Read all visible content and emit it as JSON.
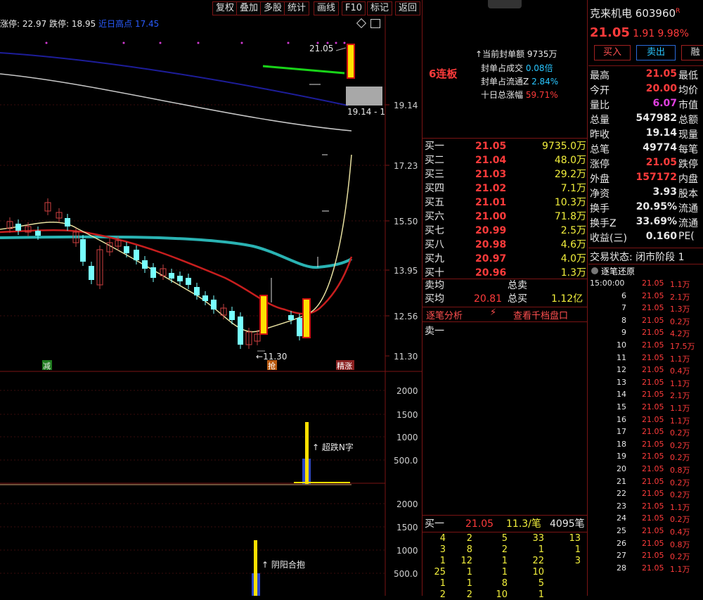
{
  "toolbar": {
    "buttons": [
      "复权",
      "叠加",
      "多股",
      "统计",
      "画线",
      "F10",
      "标记",
      "返回"
    ]
  },
  "chart_header": {
    "limit_up": "涨停: 22.97",
    "limit_down": "跌停: 18.95",
    "recent_label": "近日高点",
    "recent_value": "17.45"
  },
  "price_axis": [
    "19.14",
    "17.23",
    "15.50",
    "13.95",
    "12.56",
    "11.30"
  ],
  "annotations": {
    "last_high": "21.05",
    "prev_close": "19.14 - 1",
    "low_label": "11.30",
    "tag_left": "减",
    "tag_mid": "抢",
    "tag_right": "精涨"
  },
  "vol1": {
    "axis": [
      "2000",
      "1500",
      "1000",
      "500.0"
    ],
    "signal": "超跌N字"
  },
  "vol2": {
    "axis": [
      "2000",
      "1500",
      "1000",
      "500.0"
    ],
    "signal": "阴阳合抱"
  },
  "seal_info": {
    "title": "6连板",
    "rows": [
      {
        "label": "当前封单额",
        "value": "9735万"
      },
      {
        "label": "封单占成交",
        "value": "0.08倍"
      },
      {
        "label": "封单占流通Z",
        "value": "2.84%"
      },
      {
        "label": "十日总涨幅",
        "value": "59.71%"
      }
    ]
  },
  "book": {
    "bids": [
      {
        "label": "买一",
        "price": "21.05",
        "vol": "9735.0万"
      },
      {
        "label": "买二",
        "price": "21.04",
        "vol": "48.0万"
      },
      {
        "label": "买三",
        "price": "21.03",
        "vol": "29.2万"
      },
      {
        "label": "买四",
        "price": "21.02",
        "vol": "7.1万"
      },
      {
        "label": "买五",
        "price": "21.01",
        "vol": "10.3万"
      },
      {
        "label": "买六",
        "price": "21.00",
        "vol": "71.8万"
      },
      {
        "label": "买七",
        "price": "20.99",
        "vol": "2.5万"
      },
      {
        "label": "买八",
        "price": "20.98",
        "vol": "4.6万"
      },
      {
        "label": "买九",
        "price": "20.97",
        "vol": "4.0万"
      },
      {
        "label": "买十",
        "price": "20.96",
        "vol": "1.3万"
      }
    ],
    "ask_avg_label": "卖均",
    "ask_total_label": "总卖",
    "bid_avg_label": "买均",
    "bid_avg": "20.81",
    "bid_total_label": "总买",
    "bid_total": "1.12亿",
    "tab_tick": "逐笔分析",
    "tab_depth": "查看千档盘口",
    "sell1": "卖一",
    "queue_header": {
      "label": "买一",
      "price": "21.05",
      "per": "11.3/笔",
      "count": "4095笔"
    },
    "queue": [
      [
        "4",
        "2",
        "5",
        "33",
        "13"
      ],
      [
        "3",
        "8",
        "2",
        "1",
        "1"
      ],
      [
        "1",
        "12",
        "1",
        "22",
        "3"
      ],
      [
        "25",
        "1",
        "1",
        "10",
        ""
      ],
      [
        "1",
        "1",
        "8",
        "5",
        ""
      ],
      [
        "2",
        "2",
        "10",
        "1",
        ""
      ]
    ]
  },
  "stock": {
    "name": "克来机电",
    "code": "603960",
    "flag": "R",
    "price": "21.05",
    "change": "1.91",
    "pct": "9.98%",
    "buy": "买入",
    "sell": "卖出",
    "more": "融"
  },
  "stats": [
    {
      "l": "最高",
      "v": "21.05",
      "c": "red",
      "r": "最低"
    },
    {
      "l": "今开",
      "v": "20.00",
      "c": "red",
      "r": "均价"
    },
    {
      "l": "量比",
      "v": "6.07",
      "c": "magenta",
      "r": "市值"
    },
    {
      "l": "总量",
      "v": "547982",
      "c": "white",
      "r": "总额"
    },
    {
      "l": "昨收",
      "v": "19.14",
      "c": "white",
      "r": "现量"
    },
    {
      "l": "总笔",
      "v": "49774",
      "c": "white",
      "r": "每笔"
    },
    {
      "l": "涨停",
      "v": "21.05",
      "c": "red",
      "r": "跌停"
    },
    {
      "l": "外盘",
      "v": "157172",
      "c": "red",
      "r": "内盘"
    },
    {
      "l": "净资",
      "v": "3.93",
      "c": "white",
      "r": "股本"
    },
    {
      "l": "换手",
      "v": "20.95%",
      "c": "white",
      "r": "流通"
    },
    {
      "l": "换手Z",
      "v": "33.69%",
      "c": "white",
      "r": "流通"
    },
    {
      "l": "收益(三)",
      "v": "0.160",
      "c": "white",
      "r": "PE("
    }
  ],
  "trade_status": "交易状态: 闭市阶段 1",
  "tick_title": "逐笔还原",
  "ticks": [
    {
      "t": "15:00:00",
      "p": "21.05",
      "v": "1.1万"
    },
    {
      "t": "6",
      "p": "21.05",
      "v": "2.1万"
    },
    {
      "t": "7",
      "p": "21.05",
      "v": "1.3万"
    },
    {
      "t": "8",
      "p": "21.05",
      "v": "0.2万"
    },
    {
      "t": "9",
      "p": "21.05",
      "v": "4.2万"
    },
    {
      "t": "10",
      "p": "21.05",
      "v": "17.5万"
    },
    {
      "t": "11",
      "p": "21.05",
      "v": "1.1万"
    },
    {
      "t": "12",
      "p": "21.05",
      "v": "0.4万"
    },
    {
      "t": "13",
      "p": "21.05",
      "v": "1.1万"
    },
    {
      "t": "14",
      "p": "21.05",
      "v": "2.1万"
    },
    {
      "t": "15",
      "p": "21.05",
      "v": "1.1万"
    },
    {
      "t": "16",
      "p": "21.05",
      "v": "1.1万"
    },
    {
      "t": "17",
      "p": "21.05",
      "v": "0.2万"
    },
    {
      "t": "18",
      "p": "21.05",
      "v": "0.2万"
    },
    {
      "t": "19",
      "p": "21.05",
      "v": "0.2万"
    },
    {
      "t": "20",
      "p": "21.05",
      "v": "0.8万"
    },
    {
      "t": "21",
      "p": "21.05",
      "v": "0.2万"
    },
    {
      "t": "22",
      "p": "21.05",
      "v": "0.2万"
    },
    {
      "t": "23",
      "p": "21.05",
      "v": "1.1万"
    },
    {
      "t": "24",
      "p": "21.05",
      "v": "0.2万"
    },
    {
      "t": "25",
      "p": "21.05",
      "v": "0.4万"
    },
    {
      "t": "26",
      "p": "21.05",
      "v": "0.8万"
    },
    {
      "t": "27",
      "p": "21.05",
      "v": "0.2万"
    },
    {
      "t": "28",
      "p": "21.05",
      "v": "1.1万"
    }
  ]
}
